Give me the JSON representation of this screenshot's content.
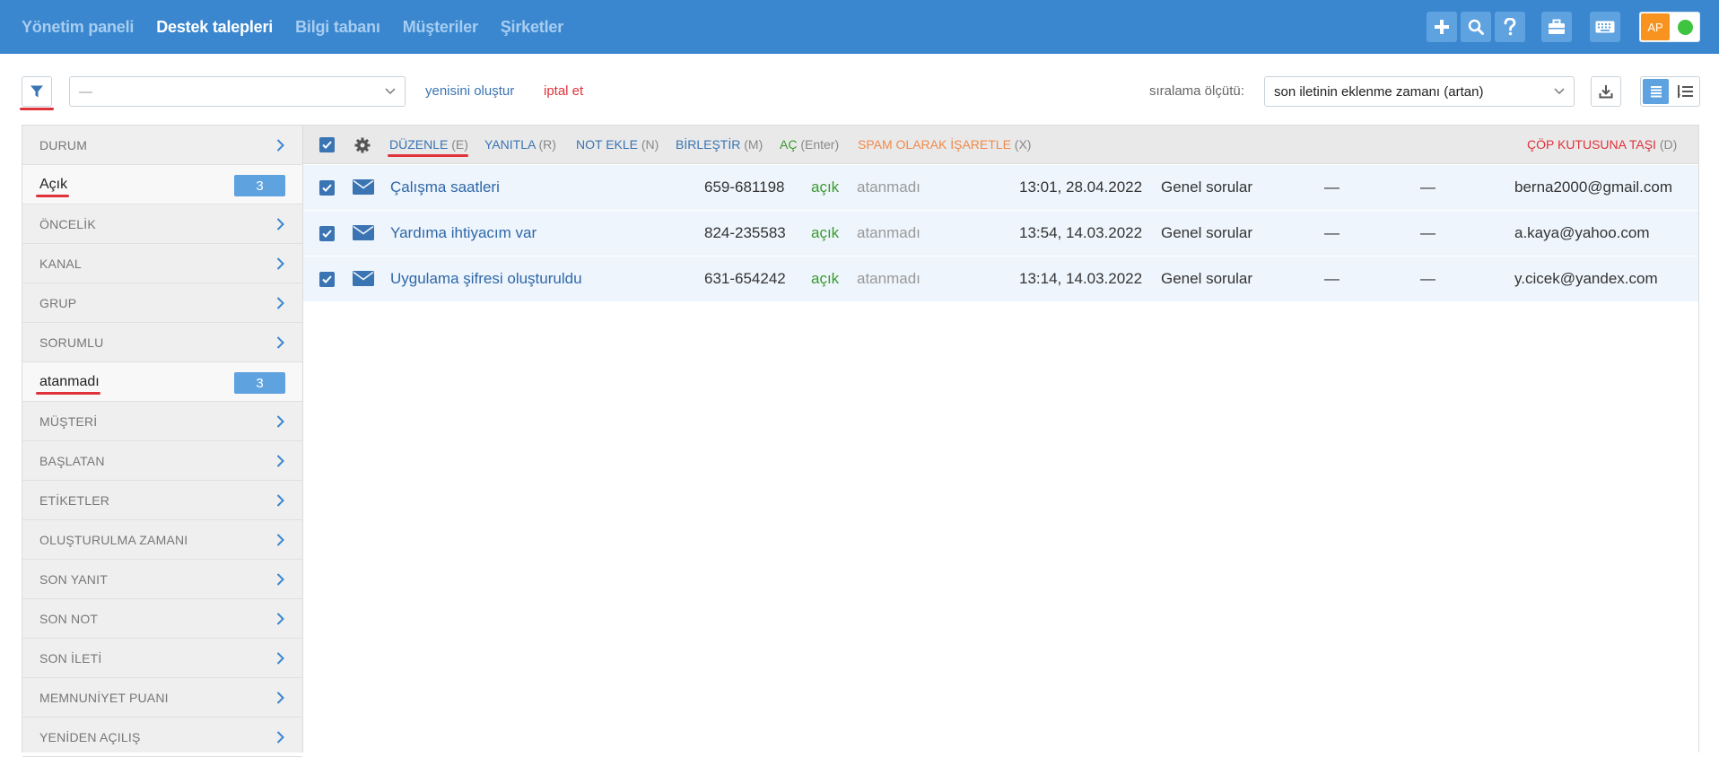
{
  "nav": {
    "items": [
      {
        "label": "Yönetim paneli",
        "active": false
      },
      {
        "label": "Destek talepleri",
        "active": true
      },
      {
        "label": "Bilgi tabanı",
        "active": false
      },
      {
        "label": "Müşteriler",
        "active": false
      },
      {
        "label": "Şirketler",
        "active": false
      }
    ],
    "tools": [
      "plus-icon",
      "search-icon",
      "help-icon",
      "briefcase-icon",
      "keyboard-icon"
    ],
    "user": {
      "initials": "AP",
      "status_color": "#3ec43e"
    }
  },
  "toolbar": {
    "filter_value": "—",
    "create_label": "yenisini oluştur",
    "cancel_label": "iptal et",
    "sort_label": "sıralama ölçütü:",
    "sort_value": "son iletinin eklenme zamanı (artan)"
  },
  "sidebar": {
    "items": [
      {
        "type": "header",
        "label": "DURUM"
      },
      {
        "type": "value",
        "label": "Açık",
        "count": "3"
      },
      {
        "type": "header",
        "label": "ÖNCELİK"
      },
      {
        "type": "header",
        "label": "KANAL"
      },
      {
        "type": "header",
        "label": "GRUP"
      },
      {
        "type": "header",
        "label": "SORUMLU"
      },
      {
        "type": "value",
        "label": "atanmadı",
        "count": "3"
      },
      {
        "type": "header",
        "label": "MÜŞTERİ"
      },
      {
        "type": "header",
        "label": "BAŞLATAN"
      },
      {
        "type": "header",
        "label": "ETİKETLER"
      },
      {
        "type": "header",
        "label": "OLUŞTURULMA ZAMANI"
      },
      {
        "type": "header",
        "label": "SON YANIT"
      },
      {
        "type": "header",
        "label": "SON NOT"
      },
      {
        "type": "header",
        "label": "SON İLETİ"
      },
      {
        "type": "header",
        "label": "MEMNUNİYET PUANI"
      },
      {
        "type": "header",
        "label": "YENİDEN AÇILIŞ"
      }
    ]
  },
  "actions": {
    "edit": {
      "label": "DÜZENLE",
      "key": "(E)"
    },
    "reply": {
      "label": "YANITLA",
      "key": "(R)"
    },
    "note": {
      "label": "NOT EKLE",
      "key": "(N)"
    },
    "merge": {
      "label": "BİRLEŞTİR",
      "key": "(M)"
    },
    "open": {
      "label": "AÇ",
      "key": "(Enter)"
    },
    "spam": {
      "label": "SPAM OLARAK İŞARETLE",
      "key": "(X)"
    },
    "trash": {
      "label": "ÇÖP KUTUSUNA TAŞI",
      "key": "(D)"
    }
  },
  "tickets": [
    {
      "subject": "Çalışma saatleri",
      "number": "659-681198",
      "status": "açık",
      "assignee": "atanmadı",
      "date": "13:01, 28.04.2022",
      "group": "Genel sorular",
      "col1": "—",
      "col2": "—",
      "email": "berna2000@gmail.com"
    },
    {
      "subject": "Yardıma ihtiyacım var",
      "number": "824-235583",
      "status": "açık",
      "assignee": "atanmadı",
      "date": "13:54, 14.03.2022",
      "group": "Genel sorular",
      "col1": "—",
      "col2": "—",
      "email": "a.kaya@yahoo.com"
    },
    {
      "subject": "Uygulama şifresi oluşturuldu",
      "number": "631-654242",
      "status": "açık",
      "assignee": "atanmadı",
      "date": "13:14, 14.03.2022",
      "group": "Genel sorular",
      "col1": "—",
      "col2": "—",
      "email": "y.cicek@yandex.com"
    }
  ],
  "colors": {
    "topbar": "#3a87cf",
    "accent": "#5ea2e0",
    "link": "#3a74b3",
    "danger": "#e0323a",
    "success": "#3a9a2e",
    "warning": "#f08a4b"
  }
}
